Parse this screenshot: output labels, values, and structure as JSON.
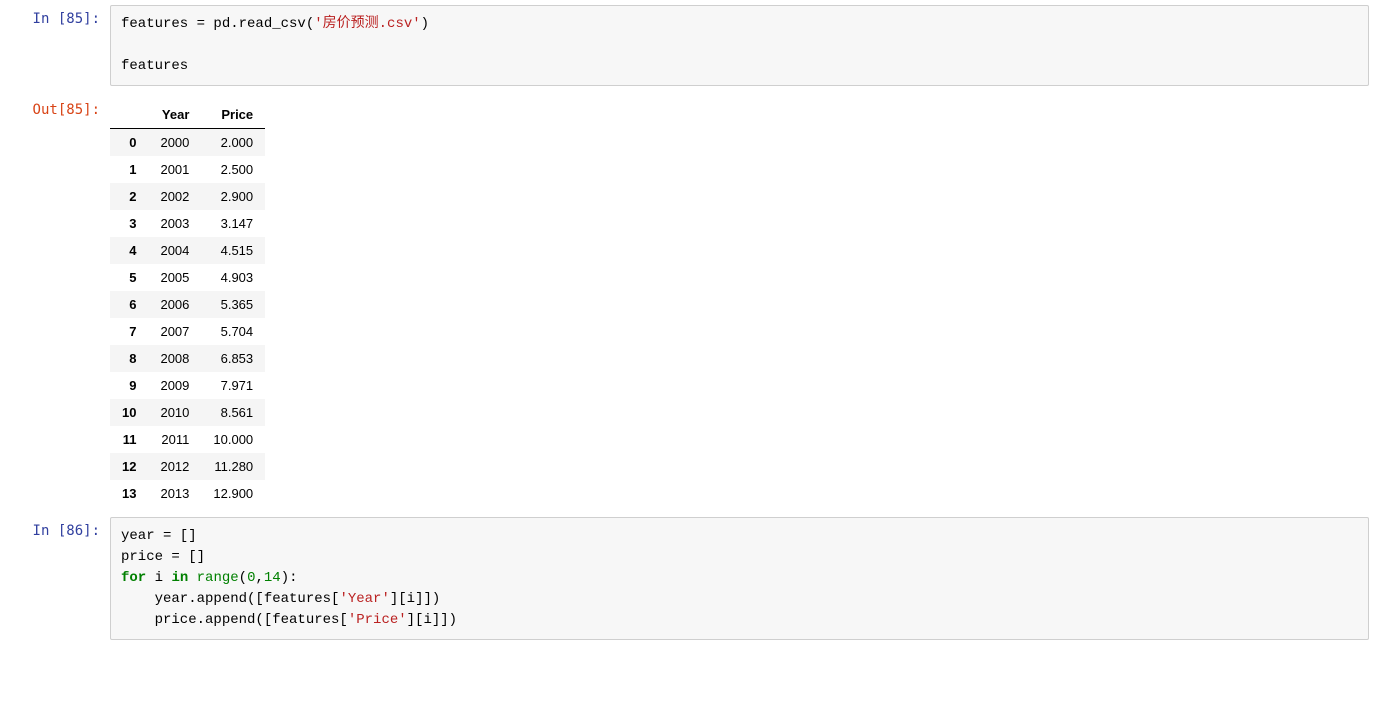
{
  "cells": {
    "c85": {
      "in_prompt_prefix": "In ",
      "in_prompt_num": "[85]",
      "in_prompt_suffix": ": ",
      "out_prompt_prefix": "Out",
      "out_prompt_num": "[85]",
      "out_prompt_suffix": ": ",
      "code": {
        "line1_a": "features = pd.read_csv(",
        "line1_str": "'房价预测.csv'",
        "line1_b": ")",
        "blank": "",
        "line3": "features"
      },
      "table": {
        "headers": {
          "index": "",
          "year": "Year",
          "price": "Price"
        },
        "rows": [
          {
            "idx": "0",
            "year": "2000",
            "price": "2.000"
          },
          {
            "idx": "1",
            "year": "2001",
            "price": "2.500"
          },
          {
            "idx": "2",
            "year": "2002",
            "price": "2.900"
          },
          {
            "idx": "3",
            "year": "2003",
            "price": "3.147"
          },
          {
            "idx": "4",
            "year": "2004",
            "price": "4.515"
          },
          {
            "idx": "5",
            "year": "2005",
            "price": "4.903"
          },
          {
            "idx": "6",
            "year": "2006",
            "price": "5.365"
          },
          {
            "idx": "7",
            "year": "2007",
            "price": "5.704"
          },
          {
            "idx": "8",
            "year": "2008",
            "price": "6.853"
          },
          {
            "idx": "9",
            "year": "2009",
            "price": "7.971"
          },
          {
            "idx": "10",
            "year": "2010",
            "price": "8.561"
          },
          {
            "idx": "11",
            "year": "2011",
            "price": "10.000"
          },
          {
            "idx": "12",
            "year": "2012",
            "price": "11.280"
          },
          {
            "idx": "13",
            "year": "2013",
            "price": "12.900"
          }
        ]
      }
    },
    "c86": {
      "in_prompt_prefix": "In ",
      "in_prompt_num": "[86]",
      "in_prompt_suffix": ": ",
      "code": {
        "l1": "year = []",
        "l2": "price = []",
        "l3_for": "for",
        "l3_i": " i ",
        "l3_in": "in",
        "l3_sp": " ",
        "l3_range": "range",
        "l3_open": "(",
        "l3_n0": "0",
        "l3_comma": ",",
        "l3_n14": "14",
        "l3_close": "):",
        "l4_a": "    year.append([features[",
        "l4_str": "'Year'",
        "l4_b": "][i]])",
        "l5_a": "    price.append([features[",
        "l5_str": "'Price'",
        "l5_b": "][i]])"
      }
    }
  }
}
